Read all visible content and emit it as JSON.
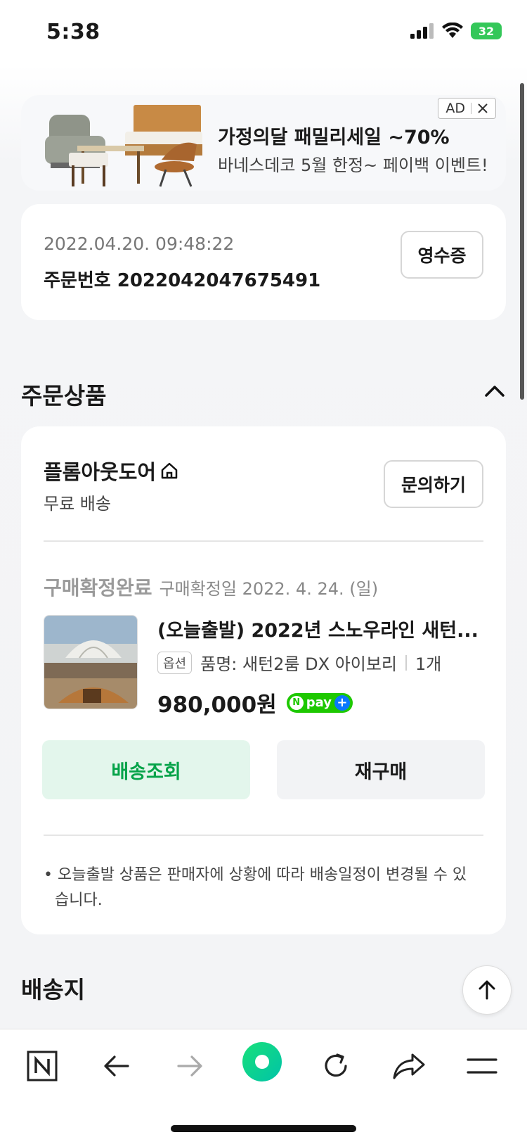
{
  "status_bar": {
    "time": "5:38",
    "battery": "32"
  },
  "ad": {
    "badge": "AD",
    "title": "가정의달 패밀리세일 ~70%",
    "subtitle": "바네스데코 5월 한정~ 페이백 이벤트!"
  },
  "order": {
    "datetime": "2022.04.20. 09:48:22",
    "order_number": "주문번호 2022042047675491",
    "receipt_label": "영수증"
  },
  "ordered_items": {
    "section_title": "주문상품",
    "seller": "플롬아웃도어",
    "shipping": "무료 배송",
    "inquiry_label": "문의하기",
    "status": "구매확정완료",
    "status_date": "구매확정일 2022. 4. 24. (일)",
    "product_title": "(오늘출발) 2022년 스노우라인 새턴...",
    "option_badge": "옵션",
    "option_text": "품명: 새턴2룸 DX 아이보리",
    "quantity": "1개",
    "price": "980,000원",
    "npay_label": "pay",
    "track_label": "배송조회",
    "rebuy_label": "재구매",
    "notice": "• 오늘출발 상품은 판매자에 상황에 따라 배송일정이 변경될 수 있습니다."
  },
  "shipping_section": {
    "title": "배송지"
  },
  "colors": {
    "accent_green": "#05a349",
    "track_bg": "#e3f6ec",
    "npay_green": "#1ec800"
  }
}
